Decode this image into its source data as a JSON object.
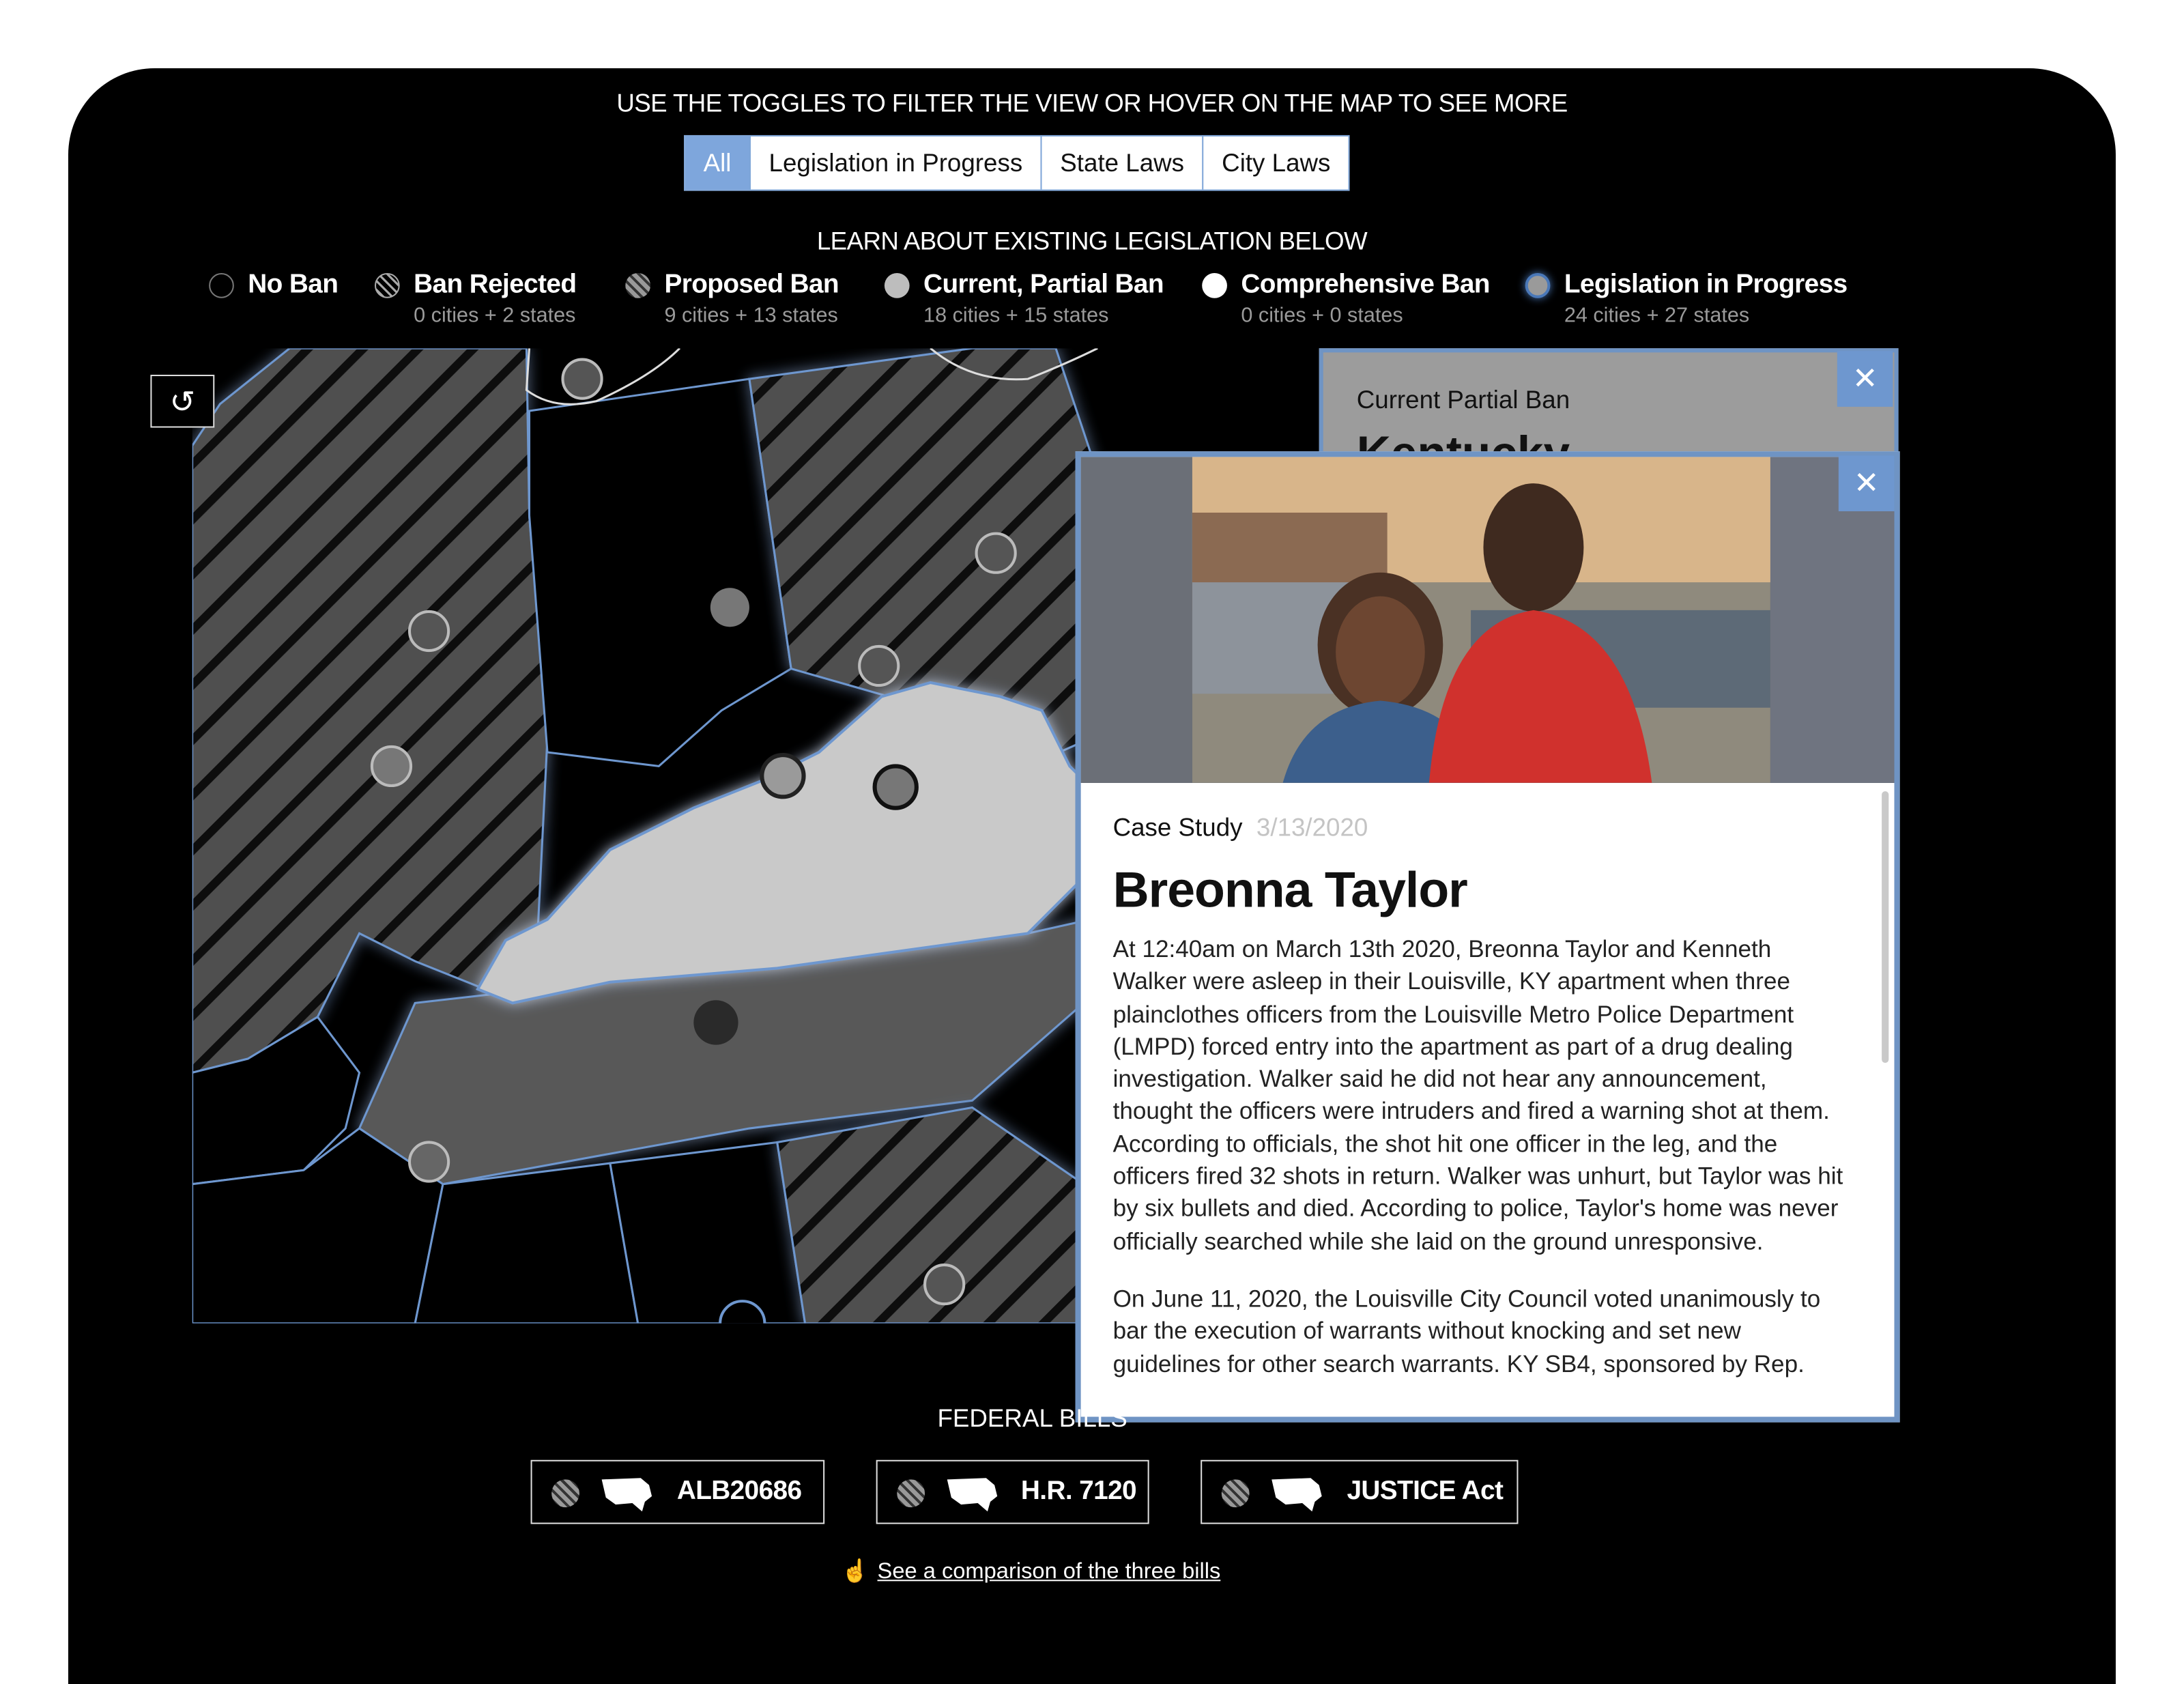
{
  "instructions": {
    "toggle_prompt": "USE THE TOGGLES TO FILTER THE VIEW OR HOVER ON THE MAP TO SEE MORE",
    "legend_prompt": "LEARN ABOUT EXISTING LEGISLATION BELOW"
  },
  "toggles": [
    {
      "label": "All",
      "active": true
    },
    {
      "label": "Legislation in Progress",
      "active": false
    },
    {
      "label": "State Laws",
      "active": false
    },
    {
      "label": "City Laws",
      "active": false
    }
  ],
  "legend": [
    {
      "label": "No Ban",
      "sub": ""
    },
    {
      "label": "Ban Rejected",
      "sub": "0 cities + 2 states"
    },
    {
      "label": "Proposed Ban",
      "sub": "9 cities + 13 states"
    },
    {
      "label": "Current, Partial Ban",
      "sub": "18 cities + 15 states"
    },
    {
      "label": "Comprehensive Ban",
      "sub": "0 cities + 0 states"
    },
    {
      "label": "Legislation in Progress",
      "sub": "24 cities + 27 states"
    }
  ],
  "map": {
    "reset_icon": "reset-icon",
    "highlighted_state": "Kentucky",
    "colors": {
      "partial_ban_fill": "#c9c9c9",
      "state_fill": "#585858",
      "accent": "#6e97cf",
      "glow": "#3d6fb3"
    }
  },
  "back_panel": {
    "category": "Current Partial Ban",
    "state": "Kentucky",
    "close_icon": "close-icon"
  },
  "case_card": {
    "label": "Case Study",
    "date": "3/13/2020",
    "title": "Breonna Taylor",
    "paragraph1": "At 12:40am on March 13th 2020, Breonna Taylor and Kenneth Walker were asleep in their Louisville, KY apartment when three plainclothes officers from the Louisville Metro Police Department (LMPD) forced entry into the apartment as part of a drug dealing investigation. Walker said he did not hear any announcement, thought the officers were intruders and fired a warning shot at them. According to officials, the shot hit one officer in the leg, and the officers fired 32 shots in return. Walker was unhurt, but Taylor was hit by six bullets and died. According to police, Taylor's home was never officially searched while she laid on the ground unresponsive.",
    "paragraph2": "On June 11, 2020, the Louisville City Council voted unanimously to bar the execution of warrants without knocking and set new guidelines for other search warrants. KY SB4, sponsored by Rep.",
    "close_icon": "close-icon"
  },
  "federal": {
    "label": "FEDERAL BILLS",
    "bills": [
      {
        "label": "ALB20686",
        "icon": "usa-map-icon"
      },
      {
        "label": "H.R. 7120",
        "icon": "usa-map-icon"
      },
      {
        "label": "JUSTICE Act",
        "icon": "usa-map-icon"
      }
    ],
    "compare_icon": "pointer-hand-icon",
    "compare_link": "See a comparison of the three bills"
  }
}
